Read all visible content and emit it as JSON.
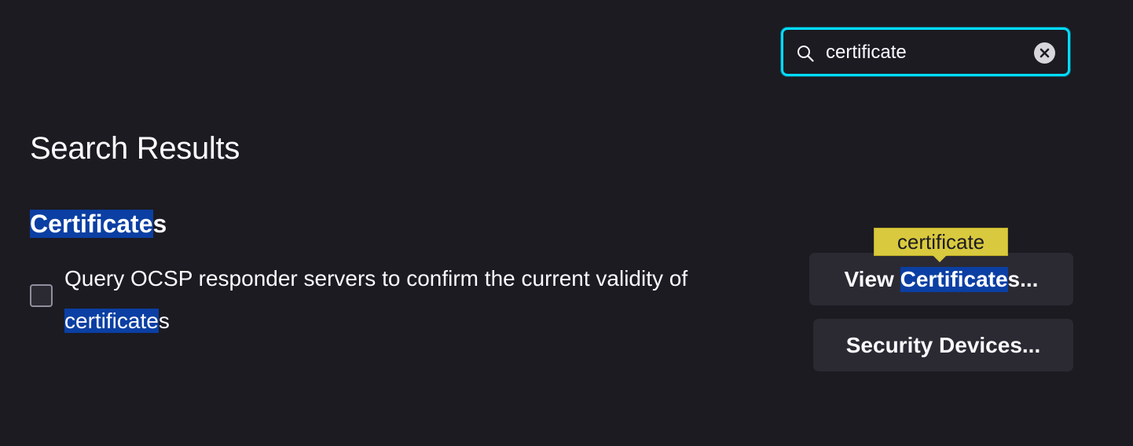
{
  "search": {
    "value": "certificate",
    "clear_icon": "clear-circle-x-icon"
  },
  "title": "Search Results",
  "section": {
    "title_highlight": "Certificate",
    "title_rest": "s"
  },
  "checkbox": {
    "checked": false,
    "label_text": "Query OCSP responder servers to confirm the current validity of ",
    "label_highlight": "certificate",
    "label_rest": "s"
  },
  "buttons": {
    "view_prefix": "View ",
    "view_highlight": "Certificate",
    "view_suffix": "s...",
    "security_devices": "Security Devices..."
  },
  "tooltip": {
    "text": "certificate"
  },
  "colors": {
    "background": "#1c1b22",
    "focus_ring": "#00ddff",
    "highlight": "#0b3fa3",
    "tooltip": "#d9c93e",
    "button": "#2b2a33"
  }
}
